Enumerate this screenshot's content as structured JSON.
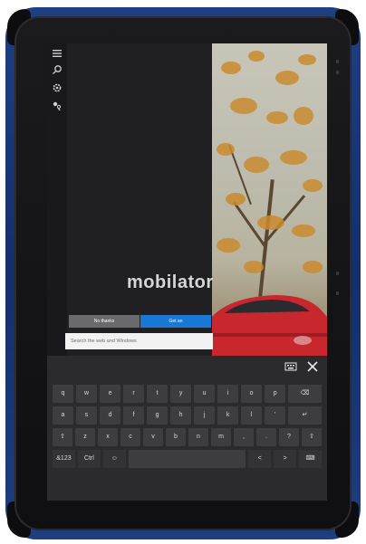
{
  "watermark": "mobilator",
  "dialog": {
    "no_label": "No thanks",
    "yes_label": "Get an",
    "search_placeholder": "Search the web and Windows"
  },
  "rail_icons": [
    "menu-icon",
    "search-icon",
    "settings-icon",
    "feedback-icon"
  ],
  "keyboard": {
    "row1": [
      "q",
      "w",
      "e",
      "r",
      "t",
      "y",
      "u",
      "i",
      "o",
      "p",
      "⌫"
    ],
    "row2": [
      "a",
      "s",
      "d",
      "f",
      "g",
      "h",
      "j",
      "k",
      "l",
      "'",
      "↵"
    ],
    "row3": [
      "⇧",
      "z",
      "x",
      "c",
      "v",
      "b",
      "n",
      "m",
      ",",
      ".",
      "?",
      "⇧"
    ],
    "row4": [
      "&123",
      "Ctrl",
      "☺",
      "",
      "<",
      ">",
      "⌨"
    ]
  }
}
